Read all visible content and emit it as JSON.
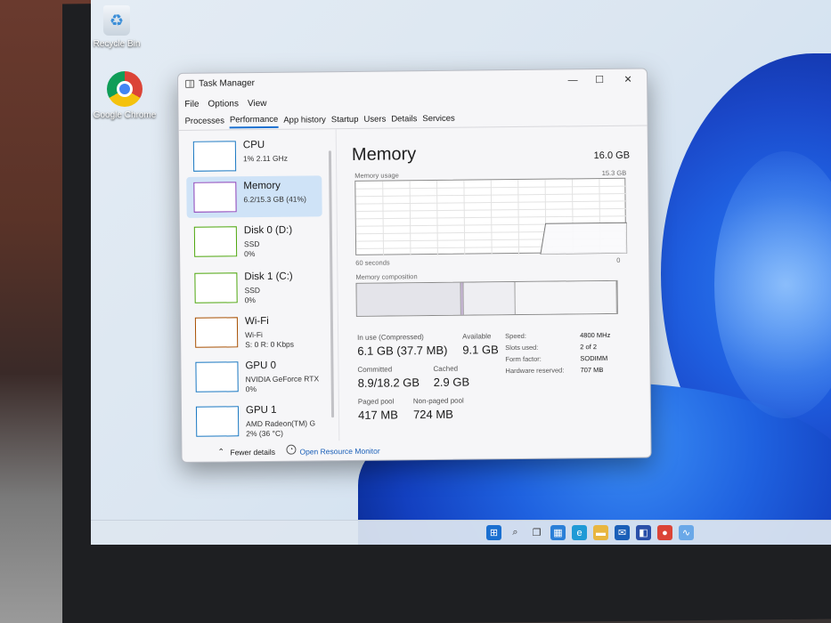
{
  "desktop": {
    "icons": [
      {
        "label": "Recycle Bin"
      },
      {
        "label": "Google Chrome"
      }
    ]
  },
  "window": {
    "title": "Task Manager",
    "controls": {
      "minimize": "—",
      "maximize": "☐",
      "close": "✕"
    },
    "menu": [
      "File",
      "Options",
      "View"
    ],
    "tabs": [
      "Processes",
      "Performance",
      "App history",
      "Startup",
      "Users",
      "Details",
      "Services"
    ],
    "active_tab": "Performance"
  },
  "sidebar": {
    "items": [
      {
        "name": "CPU",
        "lines": [
          "1% 2.11 GHz"
        ],
        "color": "#1a78c2"
      },
      {
        "name": "Memory",
        "lines": [
          "6.2/15.3 GB (41%)"
        ],
        "color": "#8a3fb8",
        "selected": true
      },
      {
        "name": "Disk 0 (D:)",
        "lines": [
          "SSD",
          "0%"
        ],
        "color": "#4da60c"
      },
      {
        "name": "Disk 1 (C:)",
        "lines": [
          "SSD",
          "0%"
        ],
        "color": "#4da60c"
      },
      {
        "name": "Wi-Fi",
        "lines": [
          "Wi-Fi",
          "S: 0 R: 0 Kbps"
        ],
        "color": "#a74f01"
      },
      {
        "name": "GPU 0",
        "lines": [
          "NVIDIA GeForce RTX",
          "0%"
        ],
        "color": "#1a78c2"
      },
      {
        "name": "GPU 1",
        "lines": [
          "AMD Radeon(TM) G",
          "2% (36 °C)"
        ],
        "color": "#1a78c2"
      }
    ]
  },
  "memory": {
    "title": "Memory",
    "total": "16.0 GB",
    "usage_label": "Memory usage",
    "usage_max": "15.3 GB",
    "x_left": "60 seconds",
    "x_right": "0",
    "composition_label": "Memory composition",
    "usage_fraction_recent": 0.41,
    "composition": {
      "in_use": 0.4,
      "modified": 0.01,
      "standby": 0.2,
      "free": 0.39
    },
    "stats": {
      "in_use_label": "In use (Compressed)",
      "in_use_value": "6.1 GB (37.7 MB)",
      "available_label": "Available",
      "available_value": "9.1 GB",
      "committed_label": "Committed",
      "committed_value": "8.9/18.2 GB",
      "cached_label": "Cached",
      "cached_value": "2.9 GB",
      "paged_label": "Paged pool",
      "paged_value": "417 MB",
      "nonpaged_label": "Non-paged pool",
      "nonpaged_value": "724 MB"
    },
    "specs": [
      {
        "label": "Speed:",
        "value": "4800 MHz"
      },
      {
        "label": "Slots used:",
        "value": "2 of 2"
      },
      {
        "label": "Form factor:",
        "value": "SODIMM"
      },
      {
        "label": "Hardware reserved:",
        "value": "707 MB"
      }
    ]
  },
  "footer": {
    "fewer_details": "Fewer details",
    "open_monitor": "Open Resource Monitor"
  },
  "taskbar": {
    "icons": [
      {
        "name": "start-icon",
        "color": "#1a6fd0"
      },
      {
        "name": "search-icon",
        "color": "#333333"
      },
      {
        "name": "task-view-icon",
        "color": "#333333"
      },
      {
        "name": "widgets-icon",
        "color": "#2a7fd8"
      },
      {
        "name": "edge-icon",
        "color": "#1f9ad6"
      },
      {
        "name": "file-explorer-icon",
        "color": "#e8b640"
      },
      {
        "name": "mail-icon",
        "color": "#1a5fb8"
      },
      {
        "name": "store-icon",
        "color": "#2a4fa8"
      },
      {
        "name": "chrome-icon",
        "color": "#db4437"
      },
      {
        "name": "task-manager-icon",
        "color": "#6aa8e8"
      }
    ]
  }
}
